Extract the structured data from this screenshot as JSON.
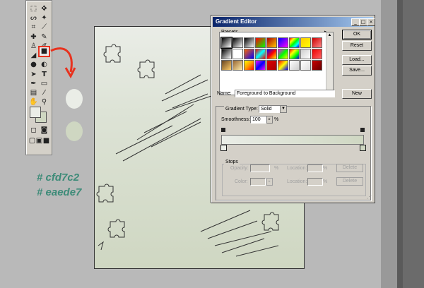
{
  "colors": {
    "foreground": "#eaede7",
    "background": "#cfd7c2",
    "annotation": "#3d8b78",
    "arrow": "#e8321e"
  },
  "annotations": [
    "# cfd7c2",
    "# eaede7"
  ],
  "toolbox": {
    "tools": [
      "marquee-tool",
      "move-tool",
      "lasso-tool",
      "magic-wand-tool",
      "crop-tool",
      "slice-tool",
      "healing-brush-tool",
      "brush-tool",
      "clone-stamp-tool",
      "history-brush-tool",
      "eraser-tool",
      "gradient-tool",
      "blur-tool",
      "dodge-tool",
      "path-selection-tool",
      "type-tool",
      "pen-tool",
      "shape-tool",
      "notes-tool",
      "eyedropper-tool",
      "hand-tool",
      "zoom-tool"
    ]
  },
  "dialog": {
    "title": "Gradient Editor",
    "presets_label": "Presets",
    "buttons": {
      "ok": "OK",
      "reset": "Reset",
      "load": "Load...",
      "save": "Save...",
      "new": "New"
    },
    "name_label": "Name:",
    "name_value": "Foreground to Background",
    "gradient_type_label": "Gradient Type:",
    "gradient_type_value": "Solid",
    "smoothness_label": "Smoothness:",
    "smoothness_value": "100",
    "smoothness_unit": "%",
    "stops_label": "Stops",
    "opacity_label": "Opacity:",
    "color_label": "Color:",
    "location_label": "Location:",
    "percent": "%",
    "delete": "Delete",
    "swatches": [
      "linear-gradient(135deg,#000,#fff)",
      "linear-gradient(135deg,#000,#fff0)",
      "linear-gradient(135deg,#000,#fff)",
      "linear-gradient(135deg,#f00,#0f0)",
      "linear-gradient(135deg,#a00,#fc0)",
      "linear-gradient(135deg,#00f,#f0f)",
      "linear-gradient(135deg,#f00,#ff0,#0f0,#0ff,#00f)",
      "linear-gradient(135deg,#fc0,#ff0)",
      "linear-gradient(135deg,#c00,#f88)",
      "linear-gradient(135deg,#000,#fff)",
      "linear-gradient(135deg,#fff,#0000)",
      "linear-gradient(135deg,#f60,#00f)",
      "linear-gradient(135deg,#f00,#0ff,#f00)",
      "linear-gradient(135deg,#00f,#f00,#ff0)",
      "linear-gradient(135deg,#f0f,#0f0,#ff0)",
      "linear-gradient(135deg,#f00,#ff0,#0f0,#00f)",
      "linear-gradient(135deg,#ccc,#fff)",
      "linear-gradient(135deg,#e00,#f66)",
      "linear-gradient(135deg,#642,#fc6)",
      "linear-gradient(135deg,#963,#fea)",
      "linear-gradient(135deg,#ff0,#f90,#f00)",
      "linear-gradient(135deg,#f0f,#00f,#f0f)",
      "linear-gradient(135deg,#d00,#a00)",
      "linear-gradient(135deg,#f00,#ff0,#00f)",
      "linear-gradient(135deg,#fff,#ccc)",
      "linear-gradient(135deg,#fff,#ddd)",
      "linear-gradient(135deg,#c00,#600)"
    ]
  }
}
